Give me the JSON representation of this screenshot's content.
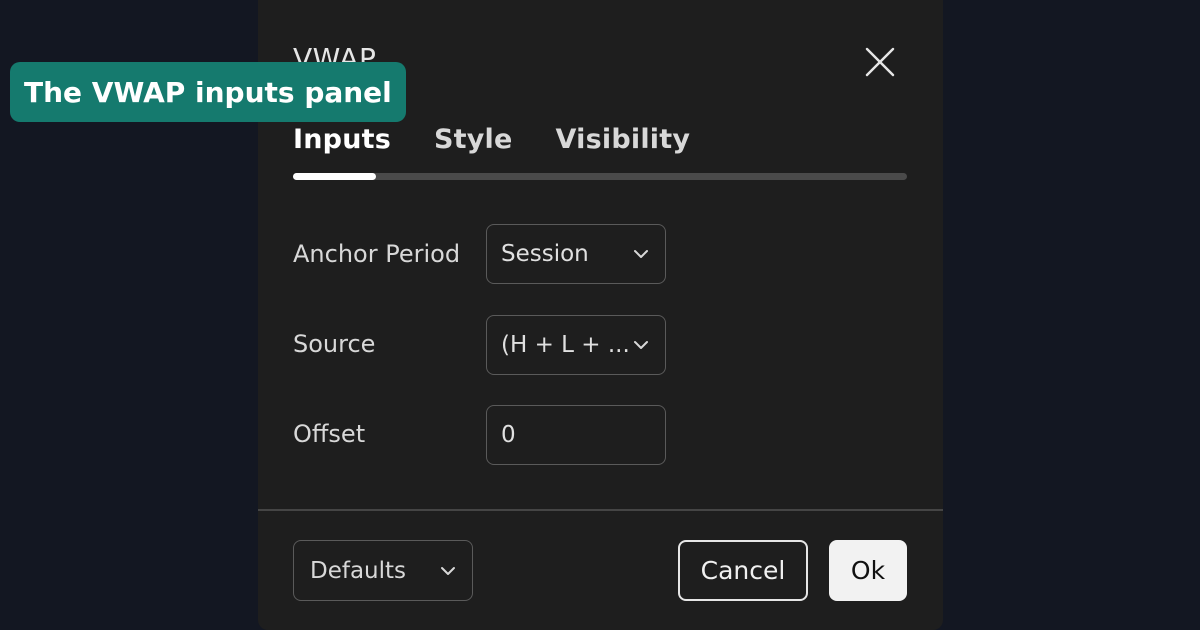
{
  "dialog": {
    "title": "VWAP",
    "close_icon": "close-icon"
  },
  "tabs": [
    {
      "label": "Inputs",
      "active": true
    },
    {
      "label": "Style",
      "active": false
    },
    {
      "label": "Visibility",
      "active": false
    }
  ],
  "inputs": {
    "anchor_period": {
      "label": "Anchor Period",
      "value": "Session"
    },
    "source": {
      "label": "Source",
      "value": "(H + L + ..."
    },
    "offset": {
      "label": "Offset",
      "value": "0"
    }
  },
  "footer": {
    "defaults_label": "Defaults",
    "cancel_label": "Cancel",
    "ok_label": "Ok"
  },
  "caption": "The VWAP inputs panel",
  "colors": {
    "background": "#131722",
    "dialog": "#1e1e1e",
    "caption": "#157a6e",
    "ok_button": "#f2f2f2"
  }
}
